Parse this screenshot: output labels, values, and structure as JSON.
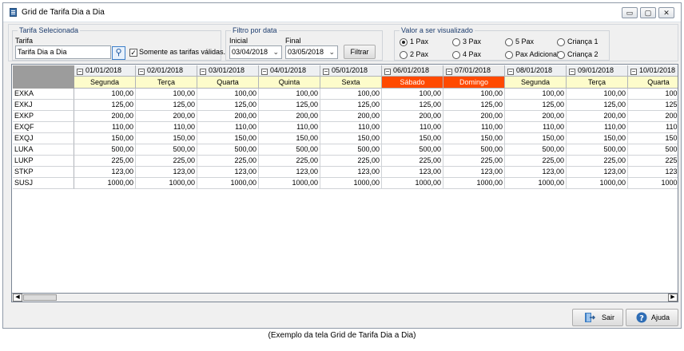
{
  "window": {
    "title": "Grid de Tarifa Dia a Dia",
    "controls": [
      "▭",
      "▢",
      "✕"
    ]
  },
  "tarifa_group": {
    "legend": "Tarifa Selecionada",
    "field_label": "Tarifa",
    "value": "Tarifa Dia a Dia",
    "checkbox_label": "Somente as tarifas válidas.",
    "checkbox_checked": true
  },
  "filtro_group": {
    "legend": "Filtro por data",
    "inicial_label": "Inicial",
    "inicial_value": "03/04/2018",
    "final_label": "Final",
    "final_value": "03/05/2018",
    "button_label": "Filtrar"
  },
  "valor_group": {
    "legend": "Valor a ser visualizado",
    "options": [
      {
        "label": "1 Pax",
        "selected": true
      },
      {
        "label": "3 Pax",
        "selected": false
      },
      {
        "label": "5 Pax",
        "selected": false
      },
      {
        "label": "Criança 1",
        "selected": false
      },
      {
        "label": "2 Pax",
        "selected": false
      },
      {
        "label": "4 Pax",
        "selected": false
      },
      {
        "label": "Pax Adicional",
        "selected": false
      },
      {
        "label": "Criança 2",
        "selected": false
      }
    ]
  },
  "grid": {
    "columns": [
      {
        "date": "01/01/2018",
        "weekday": "Segunda",
        "weekend": false
      },
      {
        "date": "02/01/2018",
        "weekday": "Terça",
        "weekend": false
      },
      {
        "date": "03/01/2018",
        "weekday": "Quarta",
        "weekend": false
      },
      {
        "date": "04/01/2018",
        "weekday": "Quinta",
        "weekend": false
      },
      {
        "date": "05/01/2018",
        "weekday": "Sexta",
        "weekend": false
      },
      {
        "date": "06/01/2018",
        "weekday": "Sábado",
        "weekend": true
      },
      {
        "date": "07/01/2018",
        "weekday": "Domingo",
        "weekend": true
      },
      {
        "date": "08/01/2018",
        "weekday": "Segunda",
        "weekend": false
      },
      {
        "date": "09/01/2018",
        "weekday": "Terça",
        "weekend": false
      },
      {
        "date": "10/01/2018",
        "weekday": "Quarta",
        "weekend": false
      }
    ],
    "rows": [
      {
        "code": "EXKA",
        "value": "100,00"
      },
      {
        "code": "EXKJ",
        "value": "125,00"
      },
      {
        "code": "EXKP",
        "value": "200,00"
      },
      {
        "code": "EXQF",
        "value": "110,00"
      },
      {
        "code": "EXQJ",
        "value": "150,00"
      },
      {
        "code": "LUKA",
        "value": "500,00"
      },
      {
        "code": "LUKP",
        "value": "225,00"
      },
      {
        "code": "STKP",
        "value": "123,00"
      },
      {
        "code": "SUSJ",
        "value": "1000,00"
      }
    ],
    "toggle_glyph": "−",
    "last_col_visible_text": {
      "header": "10/01/2018",
      "values": [
        "100",
        "125",
        "200",
        "110",
        "150",
        "500",
        "225",
        "123",
        "1000"
      ]
    }
  },
  "scrollbar": {
    "left_arrow": "◀",
    "right_arrow": "▶"
  },
  "footer": {
    "sair_label": "Sair",
    "ajuda_label": "Ajuda"
  },
  "caption": "(Exemplo da tela Grid de Tarifa Dia a Dia)"
}
